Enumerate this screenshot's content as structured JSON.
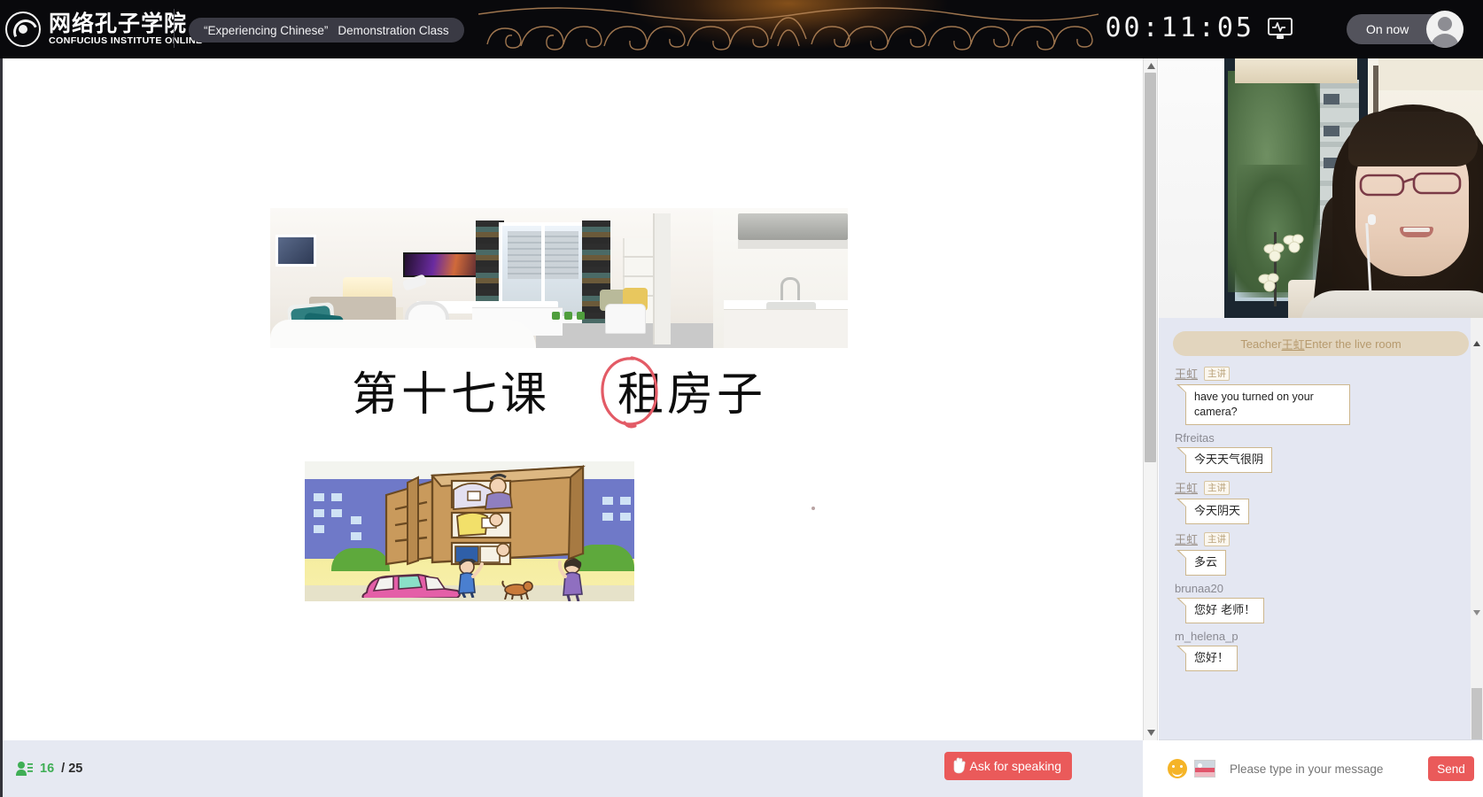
{
  "header": {
    "brand_cn": "网络孔子学院",
    "brand_en": "CONFUCIUS INSTITUTE ONLINE",
    "seal_icon": "confucius-seal-icon",
    "class_title_quoted": "“Experiencing Chinese”",
    "class_title_rest": "Demonstration Class",
    "timer": "00:11:05",
    "monitor_icon": "network-monitor-icon",
    "status_label": "On now",
    "avatar_icon": "user-avatar-icon"
  },
  "slide": {
    "lesson_number": "第十七课",
    "lesson_topic": "租房子",
    "annotation_icon": "red-circle-annotation",
    "photo_alt": "studio-apartment-photo",
    "cartoon_alt": "rent-character-cartoon"
  },
  "statusbar": {
    "people_icon": "attendees-icon",
    "attendee_count": "16",
    "attendee_total": "/ 25",
    "ask_icon": "raised-hand-icon",
    "ask_label": "Ask for speaking"
  },
  "video": {
    "presenter_alt": "teacher-webcam-video"
  },
  "chat": {
    "system_message_prefix": "Teacher ",
    "system_message_name": "王虹",
    "system_message_suffix": " Enter the live room",
    "messages": [
      {
        "name": "王虹",
        "badge": "主讲",
        "is_teacher": true,
        "text": "have you turned on your camera?",
        "lang": "en"
      },
      {
        "name": "Rfreitas",
        "badge": "",
        "is_teacher": false,
        "text": "今天天气很阴",
        "lang": "cn"
      },
      {
        "name": "王虹",
        "badge": "主讲",
        "is_teacher": true,
        "text": "今天阴天",
        "lang": "cn"
      },
      {
        "name": "王虹",
        "badge": "主讲",
        "is_teacher": true,
        "text": "多云",
        "lang": "cn"
      },
      {
        "name": "brunaa20",
        "badge": "",
        "is_teacher": false,
        "text": "您好 老师！",
        "lang": "cn"
      },
      {
        "name": "m_helena_p",
        "badge": "",
        "is_teacher": false,
        "text": "您好！",
        "lang": "cn"
      }
    ],
    "input_placeholder": "Please type in your message",
    "emoji_icon": "emoji-icon",
    "image_icon": "image-upload-icon",
    "send_label": "Send"
  },
  "colors": {
    "accent_red": "#ea5a5a",
    "panel_bg": "#e4e7f2",
    "topbar_bg": "#09090c",
    "badge_tan": "#cdb78e",
    "green": "#3fae55"
  }
}
